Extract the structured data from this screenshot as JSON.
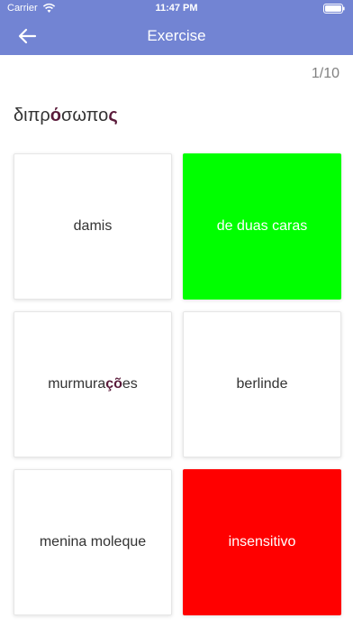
{
  "status_bar": {
    "carrier": "Carrier",
    "time": "11:47 PM",
    "wifi_icon": "wifi-icon",
    "battery_icon": "battery-icon"
  },
  "nav": {
    "title": "Exercise",
    "back_icon": "arrow-left-icon"
  },
  "progress": "1/10",
  "question": {
    "before": "διπρ",
    "highlight": "ό",
    "middle": "σωπο",
    "highlight2": "ς"
  },
  "answers": [
    {
      "label": "damis",
      "state": "neutral"
    },
    {
      "label": "de duas caras",
      "state": "correct"
    },
    {
      "before": "murmura",
      "highlight": "çõ",
      "after": "es",
      "state": "neutral"
    },
    {
      "label": "berlinde",
      "state": "neutral"
    },
    {
      "label": "menina moleque",
      "state": "neutral"
    },
    {
      "label": "insensitivo",
      "state": "wrong"
    }
  ],
  "colors": {
    "header": "#7284d3",
    "correct": "#00ff00",
    "wrong": "#ff0000",
    "highlight": "#5a1b3a"
  }
}
